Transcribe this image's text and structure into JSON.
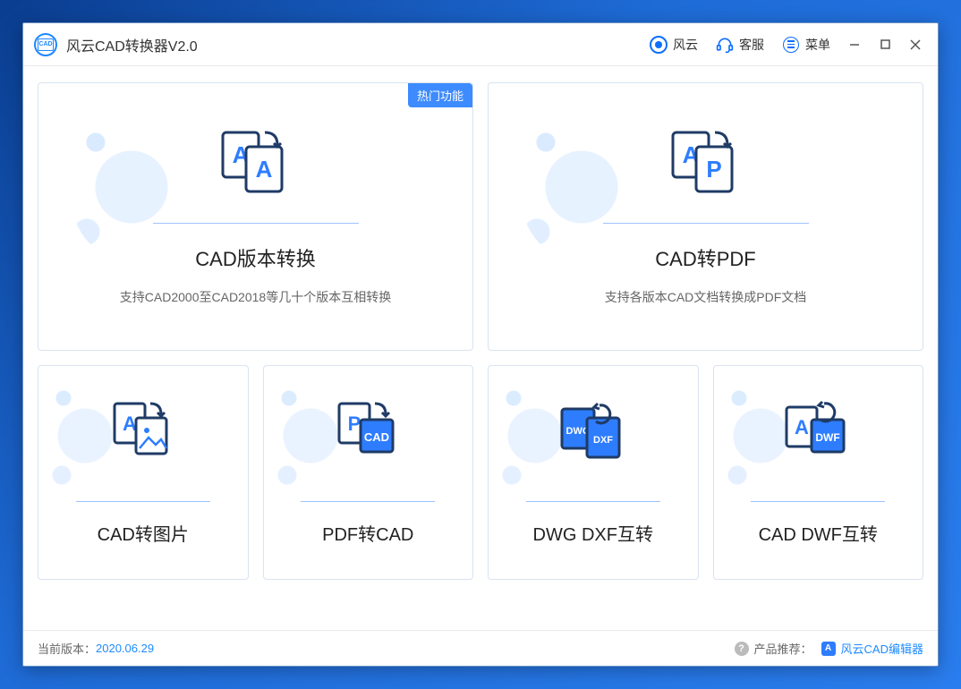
{
  "titlebar": {
    "app_title": "风云CAD转换器V2.0",
    "brand_label": "风云",
    "support_label": "客服",
    "menu_label": "菜单"
  },
  "cards": {
    "big1": {
      "badge": "热门功能",
      "title": "CAD版本转换",
      "desc": "支持CAD2000至CAD2018等几十个版本互相转换"
    },
    "big2": {
      "title": "CAD转PDF",
      "desc": "支持各版本CAD文档转换成PDF文档"
    },
    "s1": {
      "title": "CAD转图片"
    },
    "s2": {
      "title": "PDF转CAD"
    },
    "s3": {
      "title": "DWG DXF互转"
    },
    "s4": {
      "title": "CAD DWF互转"
    }
  },
  "footer": {
    "version_label": "当前版本：",
    "version_value": "2020.06.29",
    "rec_label": "产品推荐：",
    "rec_product": "风云CAD编辑器"
  },
  "colors": {
    "accent": "#3d8bff"
  }
}
